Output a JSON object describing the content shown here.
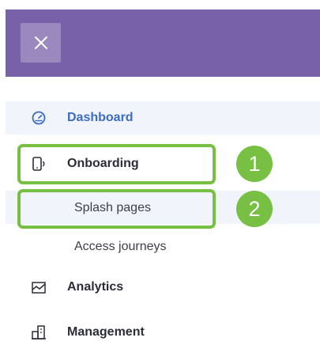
{
  "header": {
    "close_icon": "close-icon",
    "background": "#7861a8"
  },
  "nav": {
    "dashboard": {
      "label": "Dashboard",
      "icon": "speedometer-icon",
      "active": true
    },
    "onboarding": {
      "label": "Onboarding",
      "icon": "device-onboarding-icon",
      "children": [
        {
          "label": "Splash pages"
        },
        {
          "label": "Access journeys"
        }
      ]
    },
    "analytics": {
      "label": "Analytics",
      "icon": "chart-icon"
    },
    "management": {
      "label": "Management",
      "icon": "building-icon"
    }
  },
  "annotations": {
    "steps": [
      "1",
      "2"
    ],
    "color": "#77c043"
  }
}
